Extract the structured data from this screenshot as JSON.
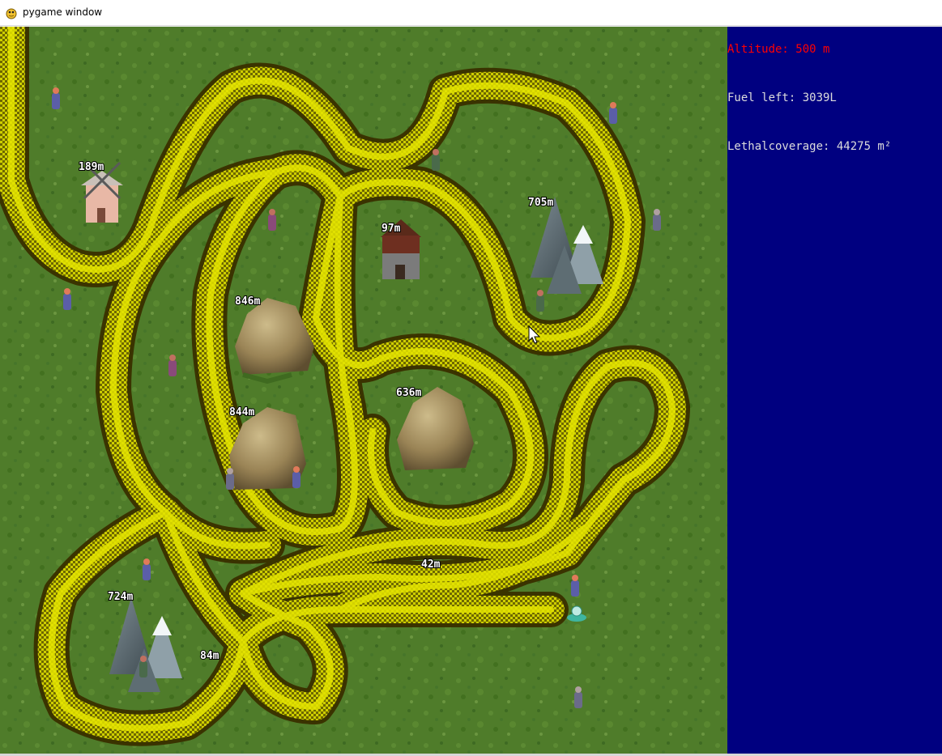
{
  "window": {
    "title": "pygame window",
    "icon": "pygame-snake-icon"
  },
  "hud": {
    "altitude": "Altitude: 500 m",
    "fuel": "Fuel left: 3039L",
    "coverage": "Lethalcoverage: 44275 m²",
    "altitude_color": "#ff0000",
    "text_color": "#dcdcdc",
    "background": "#000080"
  },
  "map": {
    "terrain": "grass",
    "trail_color": "#d6d600",
    "trail_dark": "#3a3300",
    "landmarks": [
      {
        "kind": "windmill",
        "label": "189m"
      },
      {
        "kind": "house",
        "label": "97m"
      },
      {
        "kind": "snowy-mountain",
        "label": "705m"
      },
      {
        "kind": "rock",
        "label": "846m"
      },
      {
        "kind": "rock",
        "label": "844m"
      },
      {
        "kind": "rock",
        "label": "636m"
      },
      {
        "kind": "snowy-mountain",
        "label": "724m"
      },
      {
        "kind": "small-target",
        "label": "42m"
      },
      {
        "kind": "small-target",
        "label": "84m"
      }
    ],
    "player": {
      "kind": "crop-duster-ufo"
    }
  }
}
